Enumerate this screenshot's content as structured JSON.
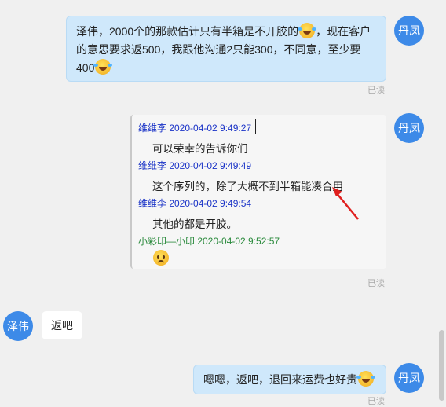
{
  "messages": {
    "m1": {
      "avatar": "丹凤",
      "part1": "泽伟，2000个的那款估计只有半箱是不开胶的",
      "part2": "，现在客户的意思要求返500，我跟他沟通2只能300，不同意，至少要400",
      "read": "已读"
    },
    "m2": {
      "avatar": "丹凤",
      "read": "已读",
      "quotes": [
        {
          "name": "维维李 2020-04-02 9:49:27",
          "text": "可以荣幸的告诉你们"
        },
        {
          "name": "维维李 2020-04-02 9:49:49",
          "text": "这个序列的，除了大概不到半箱能凑合用"
        },
        {
          "name": "维维李 2020-04-02 9:49:54",
          "text": "其他的都是开胶。"
        },
        {
          "name": "小彩印—小印 2020-04-02 9:52:57",
          "text": ""
        }
      ]
    },
    "m3": {
      "avatar": "泽伟",
      "text": "返吧"
    },
    "m4": {
      "avatar": "丹凤",
      "text": "嗯嗯，返吧，退回来运费也好贵",
      "read": "已读"
    }
  },
  "colors": {
    "avatar": "#3d8ae8",
    "outgoing_bubble": "#cfe8fb",
    "quote_name_blue": "#1a33c7",
    "quote_name_green": "#2a8a3c",
    "arrow": "#e0201f"
  },
  "icons": {
    "laugh": "laughing-tears-emoji-icon",
    "worried": "worried-face-emoji-icon"
  }
}
